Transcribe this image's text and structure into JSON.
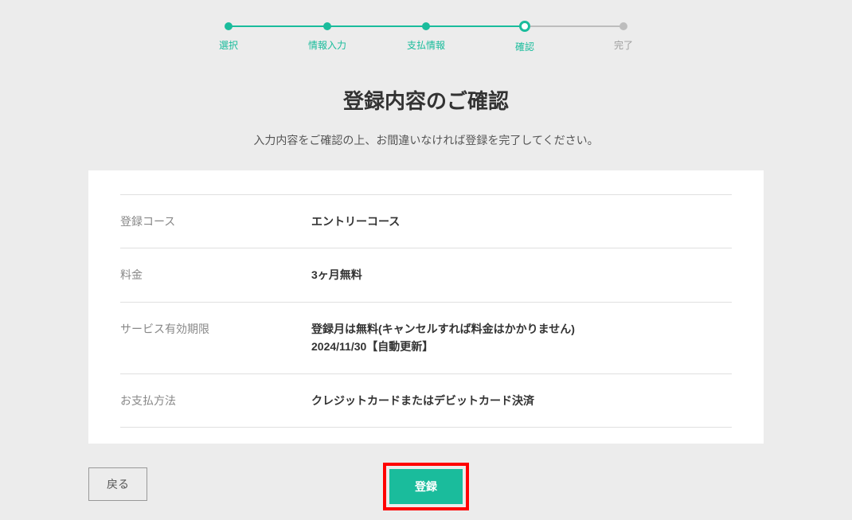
{
  "stepper": {
    "steps": [
      {
        "label": "選択",
        "state": "done"
      },
      {
        "label": "情報入力",
        "state": "done"
      },
      {
        "label": "支払情報",
        "state": "done"
      },
      {
        "label": "確認",
        "state": "current"
      },
      {
        "label": "完了",
        "state": "future"
      }
    ]
  },
  "page": {
    "title": "登録内容のご確認",
    "subtitle": "入力内容をご確認の上、お間違いなければ登録を完了してください。"
  },
  "rows": {
    "course": {
      "label": "登録コース",
      "value": "エントリーコース"
    },
    "price": {
      "label": "料金",
      "value": "3ヶ月無料"
    },
    "validity": {
      "label": "サービス有効期限",
      "value_line1": "登録月は無料(キャンセルすれば料金はかかりません)",
      "value_line2": "2024/11/30【自動更新】"
    },
    "payment": {
      "label": "お支払方法",
      "value": "クレジットカードまたはデビットカード決済"
    }
  },
  "actions": {
    "back_label": "戻る",
    "submit_label": "登録"
  }
}
